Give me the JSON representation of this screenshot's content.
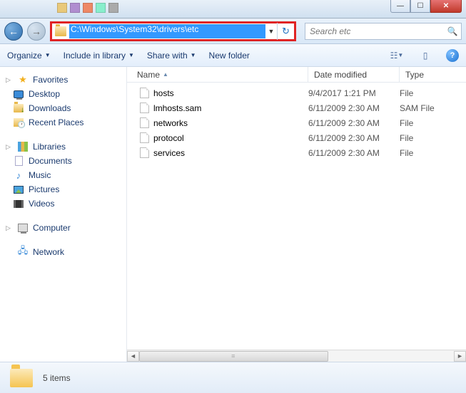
{
  "address": {
    "path": "C:\\Windows\\System32\\drivers\\etc"
  },
  "search": {
    "placeholder": "Search etc"
  },
  "toolbar": {
    "organize": "Organize",
    "include": "Include in library",
    "share": "Share with",
    "newfolder": "New folder"
  },
  "sidebar": {
    "favorites": {
      "label": "Favorites",
      "items": [
        "Desktop",
        "Downloads",
        "Recent Places"
      ]
    },
    "libraries": {
      "label": "Libraries",
      "items": [
        "Documents",
        "Music",
        "Pictures",
        "Videos"
      ]
    },
    "computer": {
      "label": "Computer"
    },
    "network": {
      "label": "Network"
    }
  },
  "columns": {
    "name": "Name",
    "date": "Date modified",
    "type": "Type"
  },
  "files": [
    {
      "name": "hosts",
      "date": "9/4/2017 1:21 PM",
      "type": "File"
    },
    {
      "name": "lmhosts.sam",
      "date": "6/11/2009 2:30 AM",
      "type": "SAM File"
    },
    {
      "name": "networks",
      "date": "6/11/2009 2:30 AM",
      "type": "File"
    },
    {
      "name": "protocol",
      "date": "6/11/2009 2:30 AM",
      "type": "File"
    },
    {
      "name": "services",
      "date": "6/11/2009 2:30 AM",
      "type": "File"
    }
  ],
  "status": {
    "count": "5 items"
  }
}
